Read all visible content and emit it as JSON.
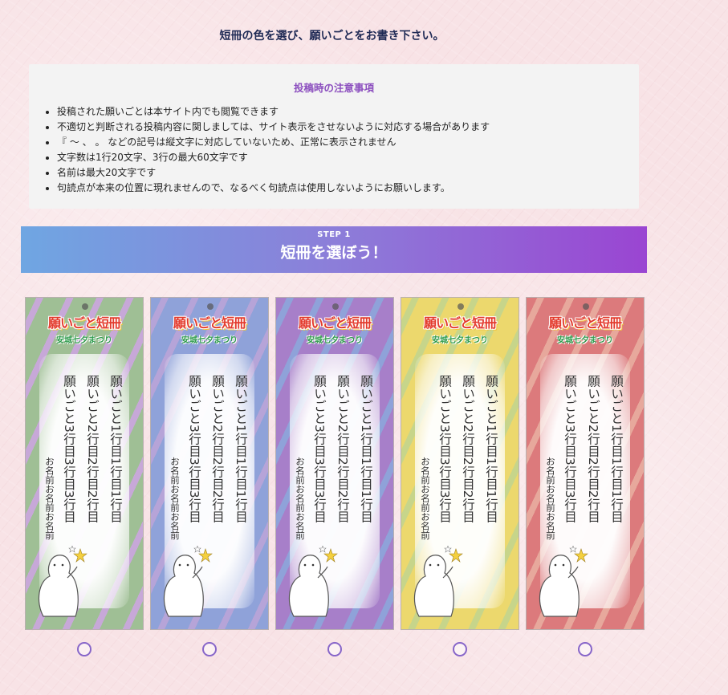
{
  "heading": "短冊の色を選び、願いごとをお書き下さい。",
  "notice": {
    "title": "投稿時の注意事項",
    "items": [
      "投稿された願いごとは本サイト内でも閲覧できます",
      "不適切と判断される投稿内容に関しましては、サイト表示をさせないように対応する場合があります",
      "『 ～ 、 。 などの記号は縦文字に対応していないため、正常に表示されません",
      "文字数は1行20文字、3行の最大60文字です",
      "名前は最大20文字です",
      "句読点が本来の位置に現れませんので、なるべく句読点は使用しないようにお願いします。"
    ]
  },
  "step": {
    "label": "STEP 1",
    "title": "短冊を選ぼう！"
  },
  "tanzaku": {
    "logo": "願いごと短冊",
    "subtitle": "安城七夕まつり",
    "line1": "願いごと1行目1行目1行目",
    "line2": "願いごと2行目2行目2行目",
    "line3": "願いごと3行目3行目3行目",
    "name": "お名前お名前お名前",
    "cards": [
      {
        "color": "green",
        "main": "#9fbf95",
        "accent": "#c7a8d8"
      },
      {
        "color": "blue",
        "main": "#8fa2d9",
        "accent": "#b6a4d8"
      },
      {
        "color": "purple",
        "main": "#a77fc9",
        "accent": "#8fa2d9"
      },
      {
        "color": "yellow",
        "main": "#ecd86d",
        "accent": "#c7d58a"
      },
      {
        "color": "red",
        "main": "#dc7a7c",
        "accent": "#e7a89c"
      }
    ]
  }
}
